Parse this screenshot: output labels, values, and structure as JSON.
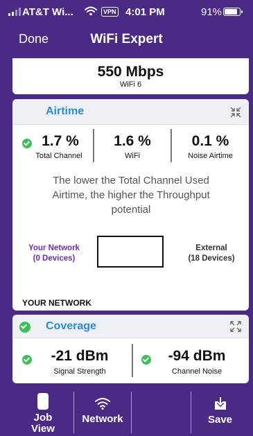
{
  "status_bar": {
    "carrier": "AT&T Wi...",
    "vpn": "VPN",
    "time": "4:01 PM",
    "battery": "91%"
  },
  "nav": {
    "done_label": "Done",
    "title": "WiFi Expert"
  },
  "speed": {
    "value": "550 Mbps",
    "standard": "WiFi 6"
  },
  "airtime": {
    "title": "Airtime",
    "stats": [
      {
        "value": "1.7 %",
        "label": "Total Channel",
        "ok": true
      },
      {
        "value": "1.6 %",
        "label": "WiFi"
      },
      {
        "value": "0.1 %",
        "label": "Noise Airtime"
      }
    ],
    "explanation": "The lower the Total Channel Used Airtime, the higher the Throughput potential",
    "your_network_label": "Your Network",
    "your_network_devices": "(0 Devices)",
    "external_label": "External",
    "external_devices": "(18 Devices)",
    "section_label": "YOUR NETWORK"
  },
  "coverage": {
    "title": "Coverage",
    "stats": [
      {
        "value": "-21 dBm",
        "label": "Signal Strength",
        "ok": true
      },
      {
        "value": "-94 dBm",
        "label": "Channel Noise",
        "ok": true
      }
    ]
  },
  "bottom_tabs": {
    "job_view": "Job View",
    "network": "Network",
    "save": "Save"
  },
  "colors": {
    "background": "#4b2a86",
    "accent_blue": "#2b8ad8",
    "ok_green": "#3cbf5a",
    "your_network_purple": "#6a2eb0"
  }
}
